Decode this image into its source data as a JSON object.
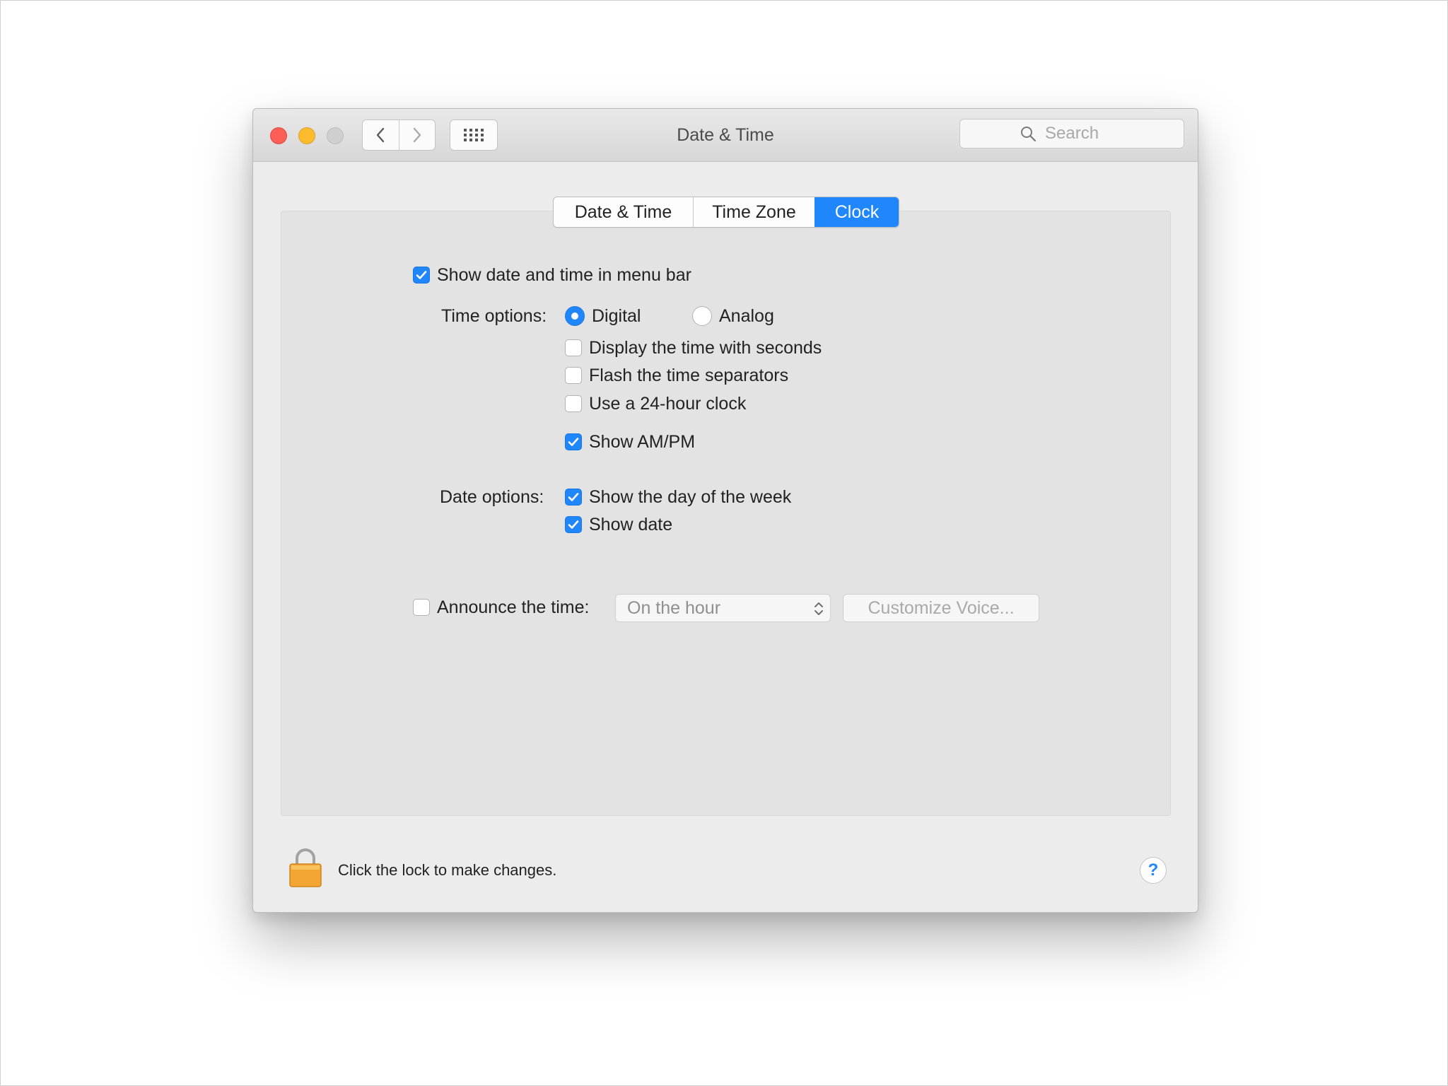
{
  "window": {
    "title": "Date & Time",
    "search_placeholder": "Search"
  },
  "tabs": [
    {
      "label": "Date & Time",
      "active": false
    },
    {
      "label": "Time Zone",
      "active": false
    },
    {
      "label": "Clock",
      "active": true
    }
  ],
  "clock": {
    "show_menu_bar": {
      "label": "Show date and time in menu bar",
      "checked": true
    },
    "time_options_label": "Time options:",
    "radio_digital": {
      "label": "Digital",
      "selected": true
    },
    "radio_analog": {
      "label": "Analog",
      "selected": false
    },
    "seconds": {
      "label": "Display the time with seconds",
      "checked": false
    },
    "flash": {
      "label": "Flash the time separators",
      "checked": false
    },
    "hour24": {
      "label": "Use a 24-hour clock",
      "checked": false
    },
    "ampm": {
      "label": "Show AM/PM",
      "checked": true
    },
    "date_options_label": "Date options:",
    "day_of_week": {
      "label": "Show the day of the week",
      "checked": true
    },
    "show_date": {
      "label": "Show date",
      "checked": true
    },
    "announce": {
      "label": "Announce the time:",
      "checked": false
    },
    "announce_interval": "On the hour",
    "customize_voice": "Customize Voice..."
  },
  "footer": {
    "lock_text": "Click the lock to make changes.",
    "help_glyph": "?"
  },
  "colors": {
    "accent": "#1f86fc",
    "close": "#fc5f57",
    "minimize": "#fdbc2e",
    "zoom_disabled": "#cfcfcf",
    "lock_body": "#f3a534"
  }
}
